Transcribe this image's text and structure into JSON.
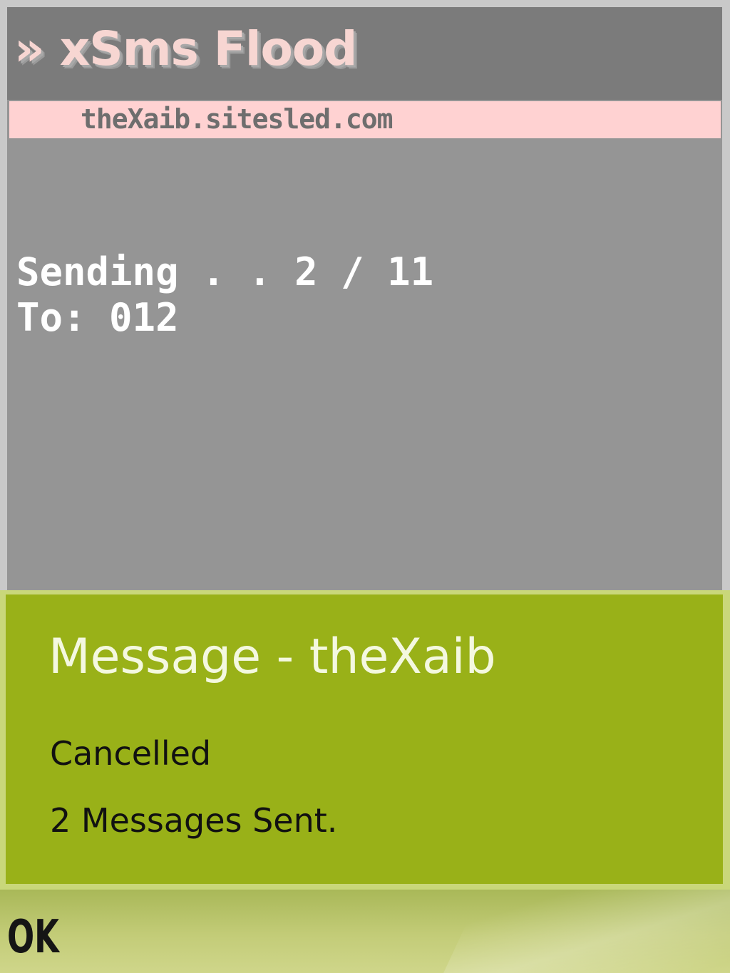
{
  "app": {
    "title": "» xSms Flood",
    "url": "theXaib.sitesled.com",
    "status": {
      "sending_line": "Sending . . 2 / 11",
      "to_line": "To: 012"
    }
  },
  "dialog": {
    "title": "Message - theXaib",
    "line1": "Cancelled",
    "line2": "2 Messages Sent."
  },
  "softkeys": {
    "left_label": "OK"
  },
  "colors": {
    "app_background": "#959595",
    "title_bar": "#7b7b7b",
    "url_bar": "#ffd2d2",
    "dialog_background": "#99b118",
    "softkey_bar": "#c3cc78"
  }
}
